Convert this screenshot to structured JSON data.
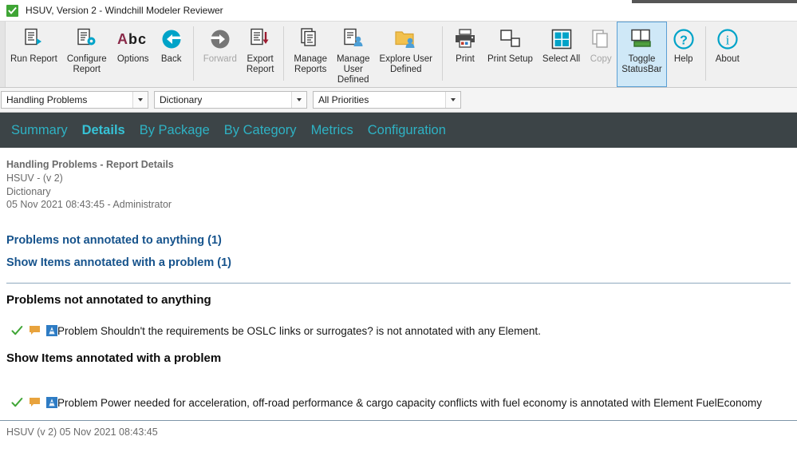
{
  "window": {
    "title": "HSUV, Version 2 - Windchill Modeler Reviewer",
    "app_icon": "green-check-icon"
  },
  "toolbar": {
    "items": [
      {
        "label": "Run Report",
        "icon": "run-report-icon",
        "state": "enabled"
      },
      {
        "label": "Configure\nReport",
        "icon": "configure-report-icon",
        "state": "enabled"
      },
      {
        "label": "Options",
        "icon": "abc-options-icon",
        "state": "enabled"
      },
      {
        "label": "Back",
        "icon": "back-arrow-icon",
        "state": "enabled"
      },
      {
        "label": "Forward",
        "icon": "forward-arrow-icon",
        "state": "disabled"
      },
      {
        "label": "Export\nReport",
        "icon": "export-report-icon",
        "state": "enabled"
      },
      {
        "label": "Manage\nReports",
        "icon": "manage-reports-icon",
        "state": "enabled"
      },
      {
        "label": "Manage\nUser\nDefined",
        "icon": "manage-user-defined-icon",
        "state": "enabled"
      },
      {
        "label": "Explore User\nDefined",
        "icon": "explore-user-defined-icon",
        "state": "enabled"
      },
      {
        "label": "Print",
        "icon": "printer-icon",
        "state": "enabled"
      },
      {
        "label": "Print Setup",
        "icon": "print-setup-icon",
        "state": "enabled"
      },
      {
        "label": "Select All",
        "icon": "select-all-icon",
        "state": "enabled"
      },
      {
        "label": "Copy",
        "icon": "copy-icon",
        "state": "disabled"
      },
      {
        "label": "Toggle\nStatusBar",
        "icon": "toggle-statusbar-icon",
        "state": "selected"
      },
      {
        "label": "Help",
        "icon": "help-question-icon",
        "state": "enabled"
      },
      {
        "label": "About",
        "icon": "about-info-icon",
        "state": "enabled"
      }
    ]
  },
  "filters": {
    "report": {
      "value": "Handling Problems"
    },
    "scope": {
      "value": "Dictionary"
    },
    "priority": {
      "value": "All Priorities"
    }
  },
  "nav": {
    "tabs": [
      {
        "label": "Summary",
        "active": false
      },
      {
        "label": "Details",
        "active": true
      },
      {
        "label": "By Package",
        "active": false
      },
      {
        "label": "By Category",
        "active": false
      },
      {
        "label": "Metrics",
        "active": false
      },
      {
        "label": "Configuration",
        "active": false
      }
    ]
  },
  "report": {
    "title": "Handling Problems - Report Details",
    "model": "HSUV - (v 2)",
    "scope": "Dictionary",
    "generated": "05 Nov 2021 08:43:45 - Administrator",
    "toc": [
      {
        "label": "Problems not annotated to anything (1)"
      },
      {
        "label": "Show Items annotated with a problem (1)"
      }
    ],
    "sections": [
      {
        "heading": "Problems not annotated to anything",
        "rows": [
          {
            "icons": [
              "green-check-icon",
              "orange-annotation-flag-icon",
              "blue-element-icon"
            ],
            "text": "Problem Shouldn't the requirements be OSLC links or surrogates? is not annotated with any Element."
          }
        ]
      },
      {
        "heading": "Show Items annotated with a problem",
        "rows": [
          {
            "icons": [
              "green-check-icon",
              "orange-annotation-flag-icon",
              "blue-element-icon"
            ],
            "text": "Problem Power needed for acceleration, off-road performance & cargo capacity conflicts with fuel economy is annotated with Element FuelEconomy"
          }
        ]
      }
    ]
  },
  "statusbar": {
    "text": "HSUV (v 2) 05 Nov 2021 08:43:45"
  },
  "colors": {
    "nav_band": "#3c4447",
    "nav_tab": "#2eb2c4",
    "link": "#16538c",
    "accent_teal": "#00a3c8",
    "check_green": "#3fa535",
    "flag_orange": "#e8a33d",
    "element_blue": "#2e7cc4",
    "selected_bg": "#cfe8f7"
  }
}
